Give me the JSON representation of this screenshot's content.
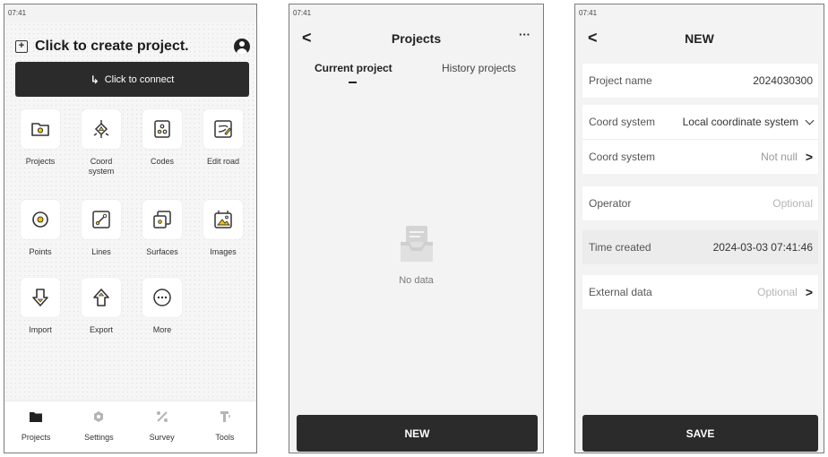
{
  "panel1": {
    "time": "07:41",
    "title": "Click to create project.",
    "connect_label": "Click to connect",
    "grid": [
      {
        "label": "Projects",
        "icon": "folder-icon"
      },
      {
        "label": "Coord system",
        "icon": "coord-system-icon"
      },
      {
        "label": "Codes",
        "icon": "codes-icon"
      },
      {
        "label": "Edit road",
        "icon": "edit-road-icon"
      },
      {
        "label": "Points",
        "icon": "points-icon"
      },
      {
        "label": "Lines",
        "icon": "lines-icon"
      },
      {
        "label": "Surfaces",
        "icon": "surfaces-icon"
      },
      {
        "label": "Images",
        "icon": "images-icon"
      },
      {
        "label": "Import",
        "icon": "import-icon"
      },
      {
        "label": "Export",
        "icon": "export-icon"
      },
      {
        "label": "More",
        "icon": "more-icon"
      }
    ],
    "nav": [
      {
        "label": "Projects",
        "icon": "projects-nav-icon"
      },
      {
        "label": "Settings",
        "icon": "settings-nav-icon"
      },
      {
        "label": "Survey",
        "icon": "survey-nav-icon"
      },
      {
        "label": "Tools",
        "icon": "tools-nav-icon"
      }
    ]
  },
  "panel2": {
    "time": "07:41",
    "back": "<",
    "title": "Projects",
    "more": "···",
    "tabs": [
      "Current project",
      "History projects"
    ],
    "empty_label": "No data",
    "new_label": "NEW"
  },
  "panel3": {
    "time": "07:41",
    "back": "<",
    "title": "NEW",
    "rows": [
      {
        "key": "Project name",
        "value": "2024030300"
      },
      {
        "key": "Coord system",
        "value": "Local coordinate system"
      },
      {
        "key": "Coord system",
        "value": "Not null"
      },
      {
        "key": "Operator",
        "value": "Optional"
      },
      {
        "key": "Time created",
        "value": "2024-03-03 07:41:46"
      },
      {
        "key": "External data",
        "value": "Optional"
      }
    ],
    "save_label": "SAVE"
  },
  "colors": {
    "dark_button": "#2b2b2b",
    "accent_yellow": "#f2c200",
    "background": "#f3f3f3"
  }
}
